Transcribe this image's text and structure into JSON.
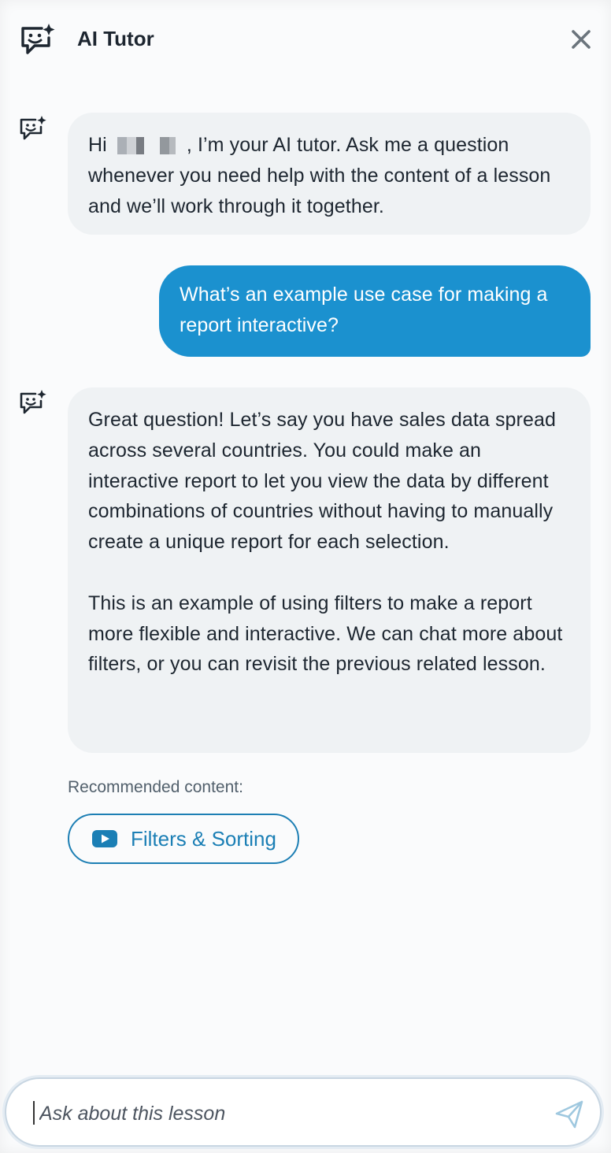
{
  "header": {
    "title": "AI Tutor"
  },
  "messages": [
    {
      "role": "bot",
      "greeting_prefix": "Hi",
      "greeting_suffix": ", I’m your AI tutor. Ask me a question whenever you need help with the content of a lesson and we’ll work through it together."
    },
    {
      "role": "user",
      "text": "What’s an example use case for making a report interactive?"
    },
    {
      "role": "bot",
      "paragraph1": "Great question! Let’s say you have sales data spread across several countries. You could make an interactive report to let you view the data by different combinations of countries without having to manually create a unique report for each selection.",
      "paragraph2": "This is an example of using filters to make a report more flexible and interactive. We can chat more about filters, or you can revisit the previous related lesson."
    }
  ],
  "recommended": {
    "label": "Recommended content:",
    "items": [
      {
        "label": "Filters & Sorting",
        "icon": "video-play-icon"
      }
    ]
  },
  "composer": {
    "placeholder": "Ask about this lesson"
  },
  "colors": {
    "accent": "#1b91cf",
    "bot_bubble": "#eff2f4",
    "chip_border": "#1d7fb4"
  }
}
